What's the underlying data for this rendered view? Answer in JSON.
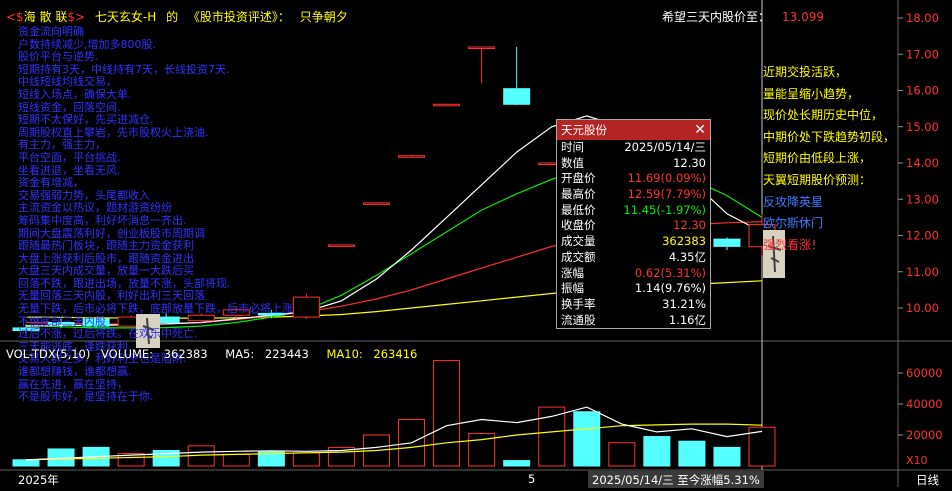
{
  "colors": {
    "up": "#ff3030",
    "down": "#54ffff",
    "ma_white": "#ffffff",
    "ma_yellow": "#ffff00",
    "ma_red": "#ff3030",
    "ma_green": "#00ee00",
    "axis_text": "#ff3030",
    "annotation_blue": "#3030ff"
  },
  "header": {
    "logo_left": "<$",
    "logo_name": "海 散 联",
    "logo_right": "$>",
    "author": "七天玄女-H",
    "of": "的",
    "column": "《股市投资评述》：",
    "motto": "只争朝夕"
  },
  "target": {
    "label": "希望三天内股价至：",
    "value": "13.099"
  },
  "notes_left": [
    "资金流向明确",
    "户数持续减少,增加多800股.",
    "股价平台与逆势.",
    "短期持有3天，中线持有7天，长线投资7天.",
    "中线短线均线交易，",
    "短线入场点，确保大单.",
    "短线资金，回落空间.",
    "短期不太保好，先买进减仓.",
    "周期股权直上攀岩，先市股权火上浇油.",
    "有主力，强主力，",
    "平台空面，平台挑战.",
    "坐看进退，坐看无风.",
    "资金有增减，",
    "交易强弱力势，头尾都收入",
    "主流资金以热议，题材游资纷纷",
    "筹码集中度高，利好坏消息一齐出.",
    "期间大盘震荡利好，创业板股市周期调",
    "跟随最热门板块，跟随主力资金获利",
    "大盘上涨获利后股市，跟随资金进出",
    "大盘三天内成交量，放量一大跌后买",
    "回落不跌，跟进出场，放量不涨，头部将现.",
    "无量回落三天内股，利好出利三天回落",
    "无量下跌，后市必将下跌，底部放量下跌，后市必将上涨",
    "不惧底部三天内股",
    "过后不涨，过后将跌。在欢乐中死亡.",
    "三天能逃底，逢跌获利.",
    "交易人群之多，利好利空也是陷阱.",
    "谁都想赚钱，谁都想赢.",
    "赢在先进，赢在坚持，",
    "不是股市好，是坚持在于你."
  ],
  "notes_right": [
    {
      "text": "近期交投活跃，",
      "style": "y"
    },
    {
      "text": "量能呈缩小趋势，",
      "style": "y"
    },
    {
      "text": "现价处长期历史中位，",
      "style": "y"
    },
    {
      "text": "中期价处下跌趋势初段，",
      "style": "y"
    },
    {
      "text": "短期价由低段上涨，",
      "style": "y"
    },
    {
      "text": "天翼短期股价预测：",
      "style": "y"
    },
    {
      "text": "反攻降英星",
      "style": "b"
    },
    {
      "text": "欧尔斯休门",
      "style": "b"
    },
    {
      "text": "强烈看涨！",
      "style": "r"
    }
  ],
  "volume_header": {
    "name": "VOL-TDX(5,10)",
    "vol_label": "VOLUME:",
    "vol_value": "362383",
    "ma5_label": "MA5:",
    "ma5_value": "223443",
    "ma10_label": "MA10:",
    "ma10_value": "263416"
  },
  "info_box": {
    "title": "天元股份",
    "close_glyph": "✕",
    "rows": [
      {
        "label": "时间",
        "value": "2025/05/14/三",
        "color": "#ffffff"
      },
      {
        "label": "数值",
        "value": "12.30",
        "color": "#ffffff"
      },
      {
        "label": "开盘价",
        "value": "11.69(0.09%)",
        "color": "#ff3030"
      },
      {
        "label": "最高价",
        "value": "12.59(7.79%)",
        "color": "#ff3030"
      },
      {
        "label": "最低价",
        "value": "11.45(-1.97%)",
        "color": "#00ee00"
      },
      {
        "label": "收盘价",
        "value": "12.30",
        "color": "#ff3030"
      },
      {
        "label": "成交量",
        "value": "362383",
        "color": "#ffff00"
      },
      {
        "label": "成交额",
        "value": "4.35亿",
        "color": "#ffffff"
      },
      {
        "label": "涨幅",
        "value": "0.62(5.31%)",
        "color": "#ff3030"
      },
      {
        "label": "振幅",
        "value": "1.14(9.76%)",
        "color": "#ffffff"
      },
      {
        "label": "换手率",
        "value": "31.21%",
        "color": "#ffffff"
      },
      {
        "label": "流通股",
        "value": "1.16亿",
        "color": "#ffffff"
      }
    ]
  },
  "x_axis": {
    "year_label": "2025年",
    "month_label": "5",
    "highlight_label": "2025/05/14/三  至今涨幅5.31%",
    "period_label": "日线"
  },
  "vol_unit": "X10",
  "chart_data": [
    {
      "type": "candlestick",
      "title": "",
      "y_ticks": [
        10.0,
        11.0,
        12.0,
        13.0,
        14.0,
        15.0,
        16.0,
        17.0,
        18.0
      ],
      "y_tick_labels": [
        "10.00",
        "11.00",
        "12.00",
        "13.00",
        "14.00",
        "15.00",
        "16.00",
        "17.00",
        "18.00"
      ],
      "ylim": [
        8.3,
        18.4
      ],
      "candles": [
        {
          "o": 9.45,
          "h": 9.55,
          "l": 9.3,
          "c": 9.38
        },
        {
          "o": 9.6,
          "h": 9.7,
          "l": 9.45,
          "c": 9.55
        },
        {
          "o": 9.7,
          "h": 9.75,
          "l": 9.45,
          "c": 9.5
        },
        {
          "o": 9.5,
          "h": 9.8,
          "l": 9.45,
          "c": 9.75
        },
        {
          "o": 9.75,
          "h": 9.85,
          "l": 9.55,
          "c": 9.6
        },
        {
          "o": 9.65,
          "h": 9.85,
          "l": 9.55,
          "c": 9.8
        },
        {
          "o": 9.8,
          "h": 10.02,
          "l": 9.7,
          "c": 9.95
        },
        {
          "o": 9.85,
          "h": 9.95,
          "l": 9.72,
          "c": 9.82
        },
        {
          "o": 9.75,
          "h": 10.4,
          "l": 9.7,
          "c": 10.3
        },
        {
          "o": 11.74,
          "h": 11.76,
          "l": 11.72,
          "c": 11.74
        },
        {
          "o": 12.9,
          "h": 12.92,
          "l": 12.88,
          "c": 12.9
        },
        {
          "o": 14.2,
          "h": 14.23,
          "l": 14.18,
          "c": 14.2
        },
        {
          "o": 15.62,
          "h": 15.64,
          "l": 15.6,
          "c": 15.62
        },
        {
          "o": 17.2,
          "h": 17.2,
          "l": 16.2,
          "c": 17.2
        },
        {
          "o": 16.05,
          "h": 17.2,
          "l": 15.6,
          "c": 15.62
        },
        {
          "o": 14.0,
          "h": 14.02,
          "l": 13.98,
          "c": 14.0
        },
        {
          "o": 12.98,
          "h": 13.6,
          "l": 12.75,
          "c": 12.75
        },
        {
          "o": 11.82,
          "h": 11.95,
          "l": 11.7,
          "c": 11.92
        },
        {
          "o": 12.2,
          "h": 12.35,
          "l": 11.85,
          "c": 11.95
        },
        {
          "o": 11.85,
          "h": 12.1,
          "l": 11.7,
          "c": 11.8
        },
        {
          "o": 11.9,
          "h": 11.95,
          "l": 11.6,
          "c": 11.7
        },
        {
          "o": 11.69,
          "h": 12.59,
          "l": 11.45,
          "c": 12.3
        }
      ],
      "ma_white": [
        9.5,
        9.52,
        9.52,
        9.54,
        9.56,
        9.6,
        9.7,
        9.8,
        9.9,
        10.2,
        10.8,
        11.6,
        12.5,
        13.4,
        14.3,
        15.0,
        15.3,
        15.0,
        14.3,
        13.5,
        12.6,
        12.1
      ],
      "ma_yellow": [
        9.75,
        9.74,
        9.73,
        9.72,
        9.72,
        9.72,
        9.73,
        9.75,
        9.78,
        9.82,
        9.9,
        10.0,
        10.1,
        10.2,
        10.3,
        10.4,
        10.48,
        10.55,
        10.6,
        10.65,
        10.7,
        10.75
      ],
      "ma_red": [
        9.6,
        9.58,
        9.56,
        9.55,
        9.56,
        9.6,
        9.68,
        9.78,
        9.9,
        10.05,
        10.25,
        10.5,
        10.8,
        11.1,
        11.4,
        11.7,
        11.95,
        12.15,
        12.25,
        12.3,
        12.35,
        12.38
      ],
      "ma_green": [
        9.52,
        9.48,
        9.45,
        9.45,
        9.46,
        9.5,
        9.6,
        9.75,
        9.95,
        10.35,
        10.9,
        11.5,
        12.1,
        12.7,
        13.15,
        13.55,
        13.85,
        13.95,
        13.85,
        13.55,
        13.1,
        12.5
      ]
    },
    {
      "type": "bar",
      "title": "",
      "y_ticks": [
        20000,
        40000,
        60000
      ],
      "y_tick_labels": [
        "20000",
        "40000",
        "60000"
      ],
      "ylim": [
        0,
        68000
      ],
      "volumes": [
        4000,
        11000,
        12000,
        8000,
        10000,
        13000,
        7500,
        9000,
        8500,
        12000,
        20000,
        30000,
        68000,
        21000,
        3500,
        38000,
        35000,
        15000,
        19000,
        16000,
        12000,
        25000
      ],
      "vol_ma5": [
        4000,
        5000,
        6000,
        7000,
        8000,
        9000,
        9500,
        9800,
        9500,
        10000,
        12000,
        15000,
        26000,
        30000,
        28000,
        32000,
        38000,
        27000,
        22000,
        24000,
        19000,
        22344
      ],
      "vol_ma10": [
        4000,
        4500,
        5000,
        5500,
        6000,
        7000,
        7500,
        8000,
        8500,
        9000,
        10000,
        12000,
        15000,
        17000,
        20000,
        22000,
        24000,
        26000,
        26500,
        27000,
        27000,
        26342
      ]
    }
  ]
}
